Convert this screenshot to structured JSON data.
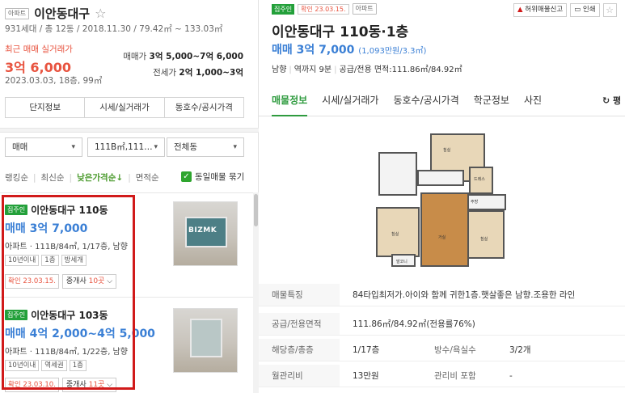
{
  "left": {
    "apt_badge": "아파트",
    "apt_name": "이안동대구",
    "apt_meta": "931세대 / 총 12동 / 2018.11.30 / 79.42㎡ ~ 133.03㎡",
    "recent_label": "최근 매매 실거래가",
    "recent_price": "3억 6,000",
    "recent_date": "2023.03.03, 18층, 99㎡",
    "sale_range_label": "매매가",
    "sale_range_value": "3억 5,000~7억 6,000",
    "jeonse_range_label": "전세가",
    "jeonse_range_value": "2억 1,000~3억",
    "tabs": [
      "단지정보",
      "시세/실거래가",
      "동호수/공시가격"
    ],
    "filters": {
      "trade_type": "매매",
      "area": "111B㎡,111…",
      "dong": "전체동"
    },
    "sort": {
      "items": [
        "랭킹순",
        "최신순",
        "낮은가격순",
        "면적순"
      ],
      "active_index": 2,
      "active_arrow": "↓"
    },
    "group_check_label": "동일매물 묶기",
    "listings": [
      {
        "badge": "집주인",
        "name": "이안동대구 110동",
        "price": "매매 3억 7,000",
        "info": "아파트 · 111B/84㎡, 1/17층, 남향",
        "tags": [
          "10년이내",
          "1층",
          "방세개"
        ],
        "confirm": "확인 23.03.15.",
        "agent_prefix": "중개사 ",
        "agent_count": "10곳",
        "watermark": "BIZMK"
      },
      {
        "badge": "집주인",
        "name": "이안동대구 103동",
        "price": "매매 4억 2,000~4억 5,000",
        "info": "아파트 · 111B/84㎡, 1/22층, 남향",
        "tags": [
          "10년이내",
          "역세권",
          "1층"
        ],
        "confirm": "확인 23.03.10.",
        "agent_prefix": "중개사 ",
        "agent_count": "11곳"
      }
    ]
  },
  "right": {
    "badges": [
      "집주인",
      "확인 23.03.15.",
      "아파트"
    ],
    "actions": {
      "report": "허위매물신고",
      "print": "인쇄"
    },
    "title": "이안동대구 110동·1층",
    "price_main": "매매 3억 7,000",
    "price_sub": "(1,093만원/3.3㎡)",
    "meta": [
      "남향",
      "역까지 9분",
      "공급/전용 면적:111.86㎡/84.92㎡"
    ],
    "tabs": [
      "매물정보",
      "시세/실거래가",
      "동호수/공시가격",
      "학군정보",
      "사진"
    ],
    "active_tab_index": 0,
    "refresh_label": "↻ 평",
    "floorplan_rooms": [
      "침실",
      "드레스",
      "침실",
      "거실",
      "주방",
      "침실",
      "발코니"
    ],
    "info_rows": [
      {
        "k": "매물특징",
        "v": "84타입최저가.아이와 함께 귀한1층.햇살좋은 남향.조용한 라인"
      },
      {
        "k": "공급/전용면적",
        "v": "111.86㎡/84.92㎡(전용률76%)"
      },
      {
        "k": "해당층/총층",
        "v": "1/17층",
        "k2": "방수/욕실수",
        "v2": "3/2개"
      },
      {
        "k": "월관리비",
        "v": "13만원",
        "k2": "관리비 포함",
        "v2": "-"
      }
    ]
  },
  "colors": {
    "accent_green": "#2f9b3f",
    "price_blue": "#3a7fd5",
    "alert_red": "#e8533f",
    "highlight_red": "#d11a1a"
  }
}
